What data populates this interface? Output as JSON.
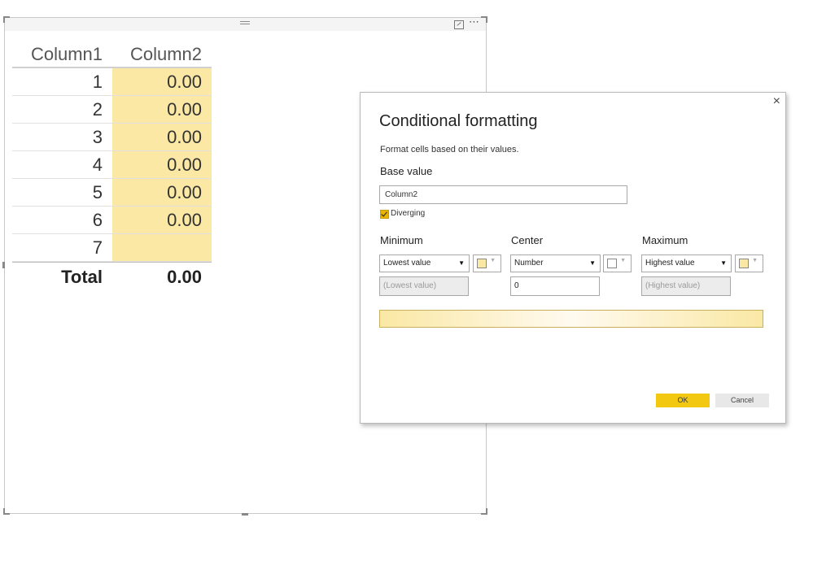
{
  "table": {
    "headers": [
      "Column1",
      "Column2"
    ],
    "rows": [
      {
        "c1": "1",
        "c2": "0.00"
      },
      {
        "c1": "2",
        "c2": "0.00"
      },
      {
        "c1": "3",
        "c2": "0.00"
      },
      {
        "c1": "4",
        "c2": "0.00"
      },
      {
        "c1": "5",
        "c2": "0.00"
      },
      {
        "c1": "6",
        "c2": "0.00"
      },
      {
        "c1": "7",
        "c2": ""
      }
    ],
    "total_label": "Total",
    "total_value": "0.00",
    "highlight_color": "#fae8a4"
  },
  "visual": {
    "more_icon": "⋯"
  },
  "dialog": {
    "close_glyph": "×",
    "title": "Conditional formatting",
    "description": "Format cells based on their values.",
    "base_value_label": "Base value",
    "base_value": "Column2",
    "diverging_label": "Diverging",
    "diverging_checked": true,
    "minimum": {
      "label": "Minimum",
      "select": "Lowest value",
      "color": "#fae8a4",
      "placeholder": "(Lowest value)"
    },
    "center": {
      "label": "Center",
      "select": "Number",
      "color": "#ffffff",
      "value": "0"
    },
    "maximum": {
      "label": "Maximum",
      "select": "Highest value",
      "color": "#fae8a4",
      "placeholder": "(Highest value)"
    },
    "ok_label": "OK",
    "cancel_label": "Cancel",
    "accent_color": "#f2c811"
  }
}
